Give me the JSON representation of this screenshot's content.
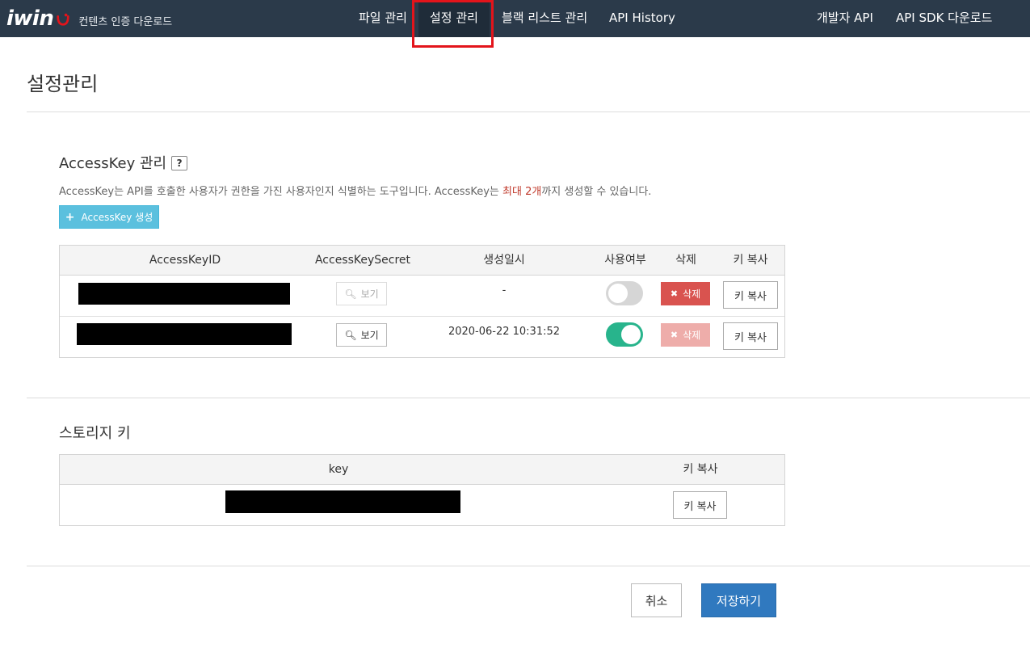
{
  "header": {
    "logo_text": "iwin",
    "logo_subtitle": "컨텐츠 인증 다운로드",
    "nav": [
      {
        "label": "파일 관리",
        "active": false
      },
      {
        "label": "설정 관리",
        "active": true
      },
      {
        "label": "블랙 리스트 관리",
        "active": false
      },
      {
        "label": "API History",
        "active": false
      }
    ],
    "nav_right": [
      {
        "label": "개발자 API"
      },
      {
        "label": "API SDK 다운로드"
      }
    ],
    "colors": {
      "bar": "#2b3a4a",
      "active_tab": "#1f2c39",
      "highlight_box": "#e3141b"
    }
  },
  "page": {
    "title": "설정관리"
  },
  "accesskey": {
    "title": "AccessKey 관리",
    "help_badge": "?",
    "description_pre": "AccessKey는 API를 호출한 사용자가 권한을 가진 사용자인지 식별하는 도구입니다. AccessKey는 ",
    "description_accent": "최대 2개",
    "description_post": "까지 생성할 수 있습니다.",
    "create_button": {
      "icon": "plus-icon",
      "label": "AccessKey 생성"
    },
    "columns": [
      "AccessKeyID",
      "AccessKeySecret",
      "생성일시",
      "사용여부",
      "삭제",
      "키 복사"
    ],
    "rows": [
      {
        "access_key_id": "",
        "secret_button": "보기",
        "secret_enabled": false,
        "created_at": "-",
        "enabled": false,
        "delete_label": "삭제",
        "delete_enabled": true,
        "copy_label": "키 복사"
      },
      {
        "access_key_id": "",
        "secret_button": "보기",
        "secret_enabled": true,
        "created_at": "2020-06-22 10:31:52",
        "enabled": true,
        "delete_label": "삭제",
        "delete_enabled": false,
        "copy_label": "키 복사"
      }
    ]
  },
  "storage": {
    "title": "스토리지 키",
    "columns": [
      "key",
      "키 복사"
    ],
    "rows": [
      {
        "key": "",
        "copy_label": "키 복사"
      }
    ]
  },
  "footer": {
    "cancel_label": "취소",
    "save_label": "저장하기",
    "colors": {
      "save": "#3079bf",
      "toggle_on": "#28b48c",
      "delete": "#d9534f",
      "create": "#5bc0de"
    }
  }
}
